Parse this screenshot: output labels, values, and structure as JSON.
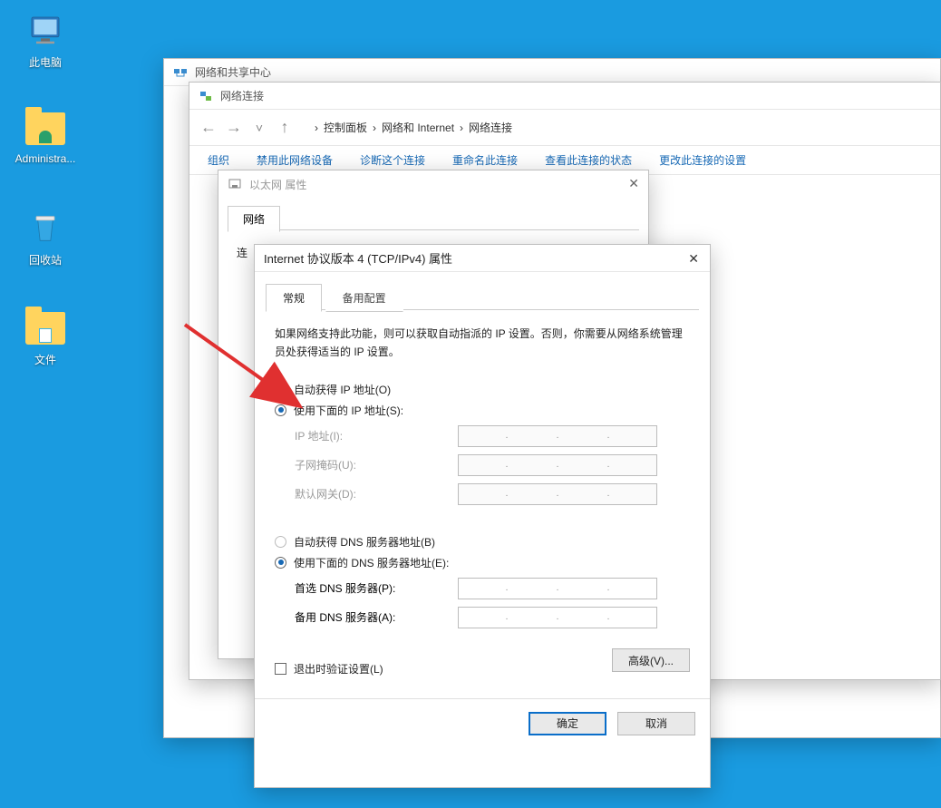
{
  "desktop": {
    "this_pc": "此电脑",
    "admin": "Administra...",
    "recycle": "回收站",
    "files": "文件"
  },
  "win_share": {
    "title": "网络和共享中心"
  },
  "win_conn": {
    "title": "网络连接",
    "breadcrumb": {
      "control_panel": "控制面板",
      "net_internet": "网络和 Internet",
      "connections": "网络连接",
      "sep": "›"
    },
    "toolbar": {
      "organize": "组织",
      "disable": "禁用此网络设备",
      "diagnose": "诊断这个连接",
      "rename": "重命名此连接",
      "status": "查看此连接的状态",
      "change": "更改此连接的设置"
    }
  },
  "win_eth": {
    "title": "以太网 属性",
    "tab": "网络",
    "connect_label": "连"
  },
  "win_ipv4": {
    "title": "Internet 协议版本 4 (TCP/IPv4) 属性",
    "tabs": {
      "general": "常规",
      "alternate": "备用配置"
    },
    "desc": "如果网络支持此功能，则可以获取自动指派的 IP 设置。否则，你需要从网络系统管理员处获得适当的 IP 设置。",
    "ip": {
      "auto": "自动获得 IP 地址(O)",
      "manual": "使用下面的 IP 地址(S):",
      "ip_addr": "IP 地址(I):",
      "subnet": "子网掩码(U):",
      "gateway": "默认网关(D):"
    },
    "dns": {
      "auto": "自动获得 DNS 服务器地址(B)",
      "manual": "使用下面的 DNS 服务器地址(E):",
      "preferred": "首选 DNS 服务器(P):",
      "alternate": "备用 DNS 服务器(A):"
    },
    "validate": "退出时验证设置(L)",
    "advanced": "高级(V)...",
    "ok": "确定",
    "cancel": "取消"
  }
}
